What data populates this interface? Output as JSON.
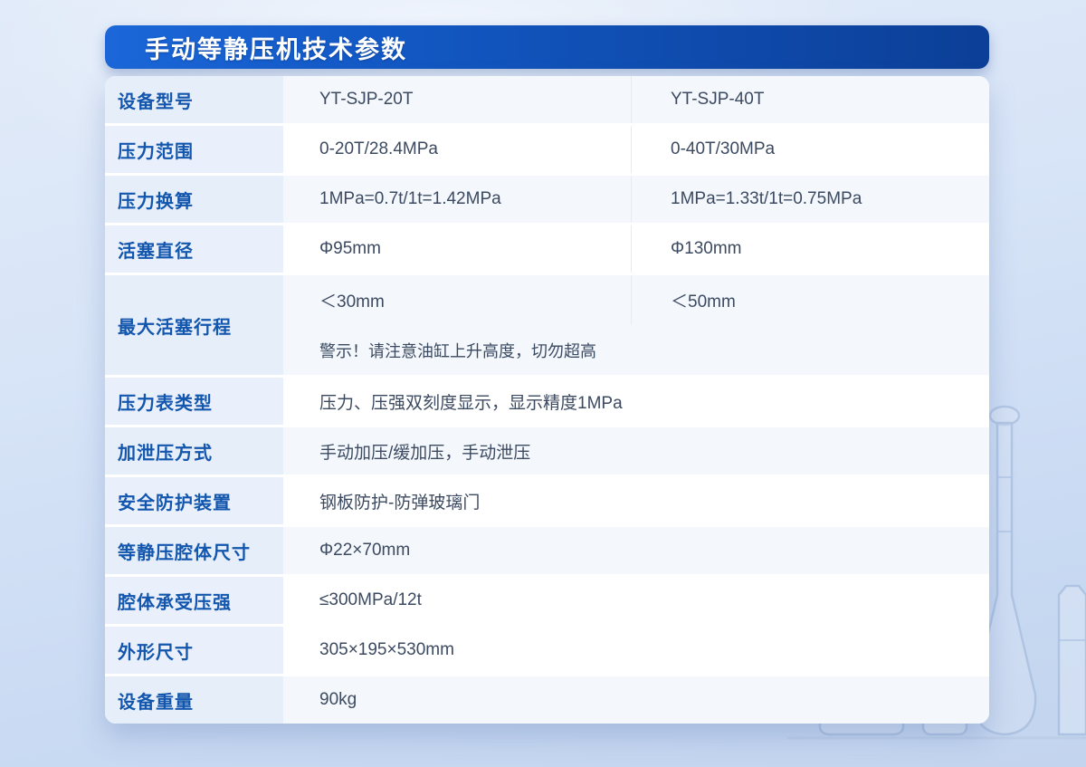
{
  "page": {
    "title": "手动等静压机技术参数"
  },
  "theme": {
    "title_gradient_start": "#1b67d9",
    "title_gradient_end": "#0c3f97",
    "label_text_color": "#1356ad",
    "value_text_color": "#3c4a61",
    "label_cell_bg": "#e9f0fb",
    "shaded_row_bg": "#f4f8fd",
    "page_bg_top": "#e2ebf9",
    "page_bg_bottom": "#c3d4ee"
  },
  "table": {
    "rows": [
      {
        "label": "设备型号",
        "col1": "YT-SJP-20T",
        "col2": "YT-SJP-40T"
      },
      {
        "label": "压力范围",
        "col1": "0-20T/28.4MPa",
        "col2": "0-40T/30MPa"
      },
      {
        "label": "压力换算",
        "col1": "1MPa=0.7t/1t=1.42MPa",
        "col2": "1MPa=1.33t/1t=0.75MPa"
      },
      {
        "label": "活塞直径",
        "col1": "Φ95mm",
        "col2": "Φ130mm"
      },
      {
        "label": "最大活塞行程",
        "col1": "＜30mm",
        "col2": "＜50mm",
        "note": "警示！请注意油缸上升高度，切勿超高"
      },
      {
        "label": "压力表类型",
        "value": "压力、压强双刻度显示，显示精度1MPa"
      },
      {
        "label": "加泄压方式",
        "value": "手动加压/缓加压，手动泄压"
      },
      {
        "label": "安全防护装置",
        "value": "钢板防护-防弹玻璃门"
      },
      {
        "label": "等静压腔体尺寸",
        "value": "Φ22×70mm"
      },
      {
        "label": "腔体承受压强",
        "value": "≤300MPa/12t"
      },
      {
        "label": "外形尺寸",
        "value": "305×195×530mm"
      },
      {
        "label": "设备重量",
        "value": "90kg"
      }
    ]
  },
  "decor": {
    "items": [
      "volumetric-flask-icon",
      "beaker-icon",
      "bottle-icon"
    ]
  }
}
